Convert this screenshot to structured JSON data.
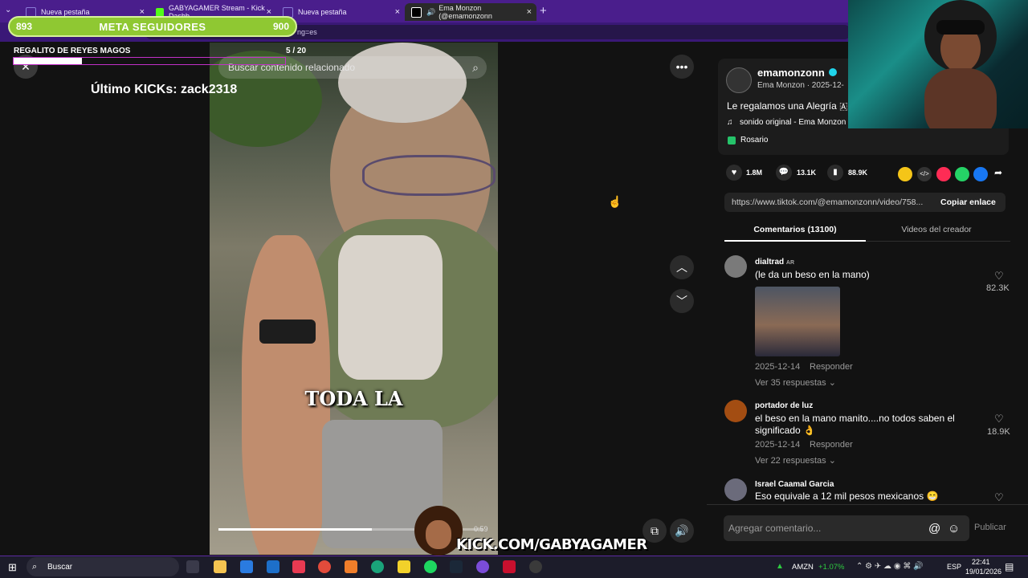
{
  "browser": {
    "tabs": [
      {
        "label": "Nueva pestaña",
        "color": "#8a7bd8"
      },
      {
        "label": "GABYAGAMER Stream - Kick Dashb",
        "color": "#53fc18"
      },
      {
        "label": "Nueva pestaña",
        "color": "#8a7bd8"
      },
      {
        "label": "Ema Monzon (@emamonzonn",
        "color": "#ffffff"
      }
    ],
    "new_tab": "+",
    "url_fragment": "ng=es"
  },
  "overlay": {
    "meta_start": "893",
    "meta_title": "META SEGUIDORES",
    "meta_end": "900",
    "regalito_label": "REGALITO DE REYES MAGOS",
    "regalito_count": "5 / 20",
    "regalito_progress": 0.25,
    "ultimo_kicks": "Último KICKs: zack2318",
    "kick_logo": "KICK.COM/GABYAGAMER"
  },
  "video": {
    "search_placeholder": "Buscar contenido relacionado",
    "caption": "TODA LA",
    "progress": 0.58,
    "time": "0:59"
  },
  "post": {
    "username": "emamonzonn",
    "display_name": "Ema Monzon · 2025-12-",
    "description": "Le regalamos una Alegría 🇦",
    "sound": "sonido original - Ema Monzon",
    "location": "Rosario",
    "likes": "1.8M",
    "comments_count": "13.1K",
    "saves": "88.9K",
    "link": "https://www.tiktok.com/@emamonzonn/video/758...",
    "copy_link": "Copiar enlace"
  },
  "tabs": {
    "comments": "Comentarios (13100)",
    "creator_videos": "Videos del creador"
  },
  "comments": [
    {
      "name": "dialtrad",
      "badge": "AR",
      "text": "(le da un beso en la mano)",
      "date": "2025-12-14",
      "reply": "Responder",
      "replies": "Ver 35 respuestas",
      "likes": "82.3K"
    },
    {
      "name": "portador de luz",
      "text": "el beso en la mano manito....no todos saben el significado 👌",
      "date": "2025-12-14",
      "reply": "Responder",
      "replies": "Ver 22 respuestas",
      "likes": "18.9K"
    },
    {
      "name": "Israel Caamal Garcia",
      "text": "Eso equivale a 12 mil pesos mexicanos 😁",
      "likes": ""
    }
  ],
  "input": {
    "placeholder": "Agregar comentario...",
    "publish": "Publicar"
  },
  "taskbar": {
    "search": "Buscar",
    "stock": "AMZN",
    "stock_change": "+1.07%",
    "lang": "ESP",
    "time": "22:41",
    "date": "19/01/2026"
  }
}
